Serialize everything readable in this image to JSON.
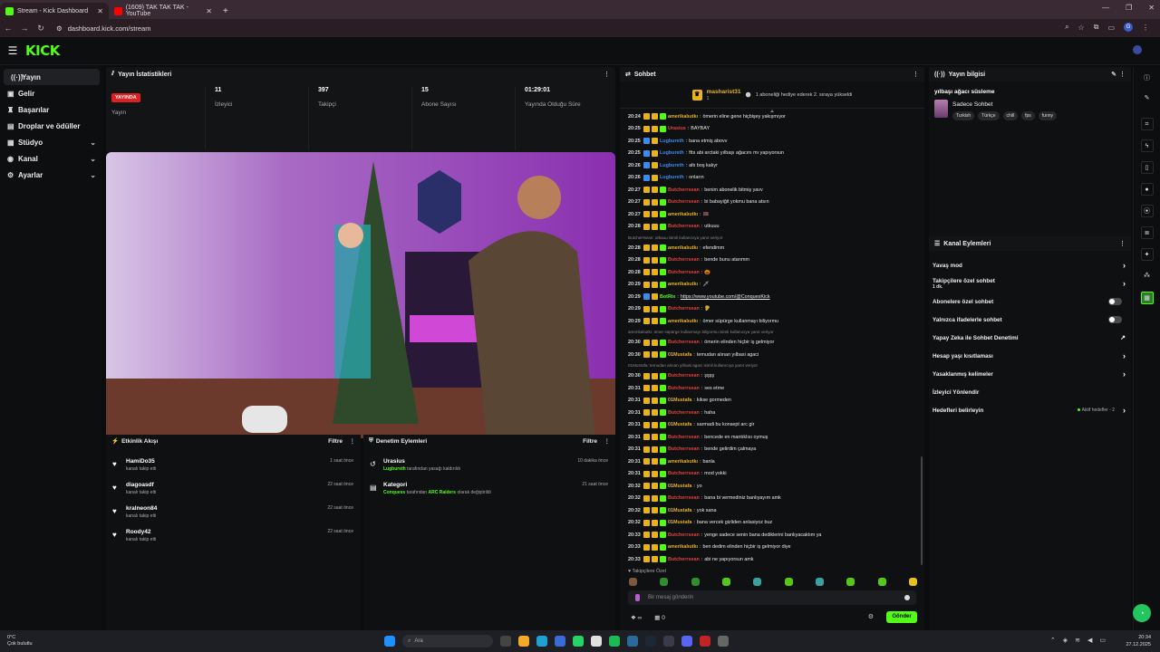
{
  "browser": {
    "tabs": [
      {
        "title": "Stream - Kick Dashboard",
        "icon": "kick-icon"
      },
      {
        "title": "(1609) TAK TAK TAK - YouTube",
        "icon": "youtube-icon"
      }
    ],
    "url": "dashboard.kick.com/stream",
    "profile_initial": "G"
  },
  "logo": "KICK",
  "sidebar": {
    "items": [
      {
        "label": "Yayın",
        "icon": "broadcast-icon",
        "active": true
      },
      {
        "label": "Gelir",
        "icon": "wallet-icon"
      },
      {
        "label": "Başarılar",
        "icon": "trophy-icon"
      },
      {
        "label": "Droplar ve ödüller",
        "icon": "gift-icon"
      },
      {
        "label": "Stüdyo",
        "icon": "studio-icon",
        "expandable": true
      },
      {
        "label": "Kanal",
        "icon": "channel-icon",
        "expandable": true
      },
      {
        "label": "Ayarlar",
        "icon": "settings-icon",
        "expandable": true
      }
    ]
  },
  "stats": {
    "title": "Yayın İstatistikleri",
    "live_badge": "YAYINDA",
    "cols": [
      {
        "value": "",
        "label": "Yayın"
      },
      {
        "value": "11",
        "label": "İzleyici"
      },
      {
        "value": "397",
        "label": "Takipçi"
      },
      {
        "value": "15",
        "label": "Abone Sayısı"
      },
      {
        "value": "01:29:01",
        "label": "Yayında Olduğu Süre"
      }
    ]
  },
  "activity": {
    "title": "Etkinlik Akışı",
    "filter": "Filtre",
    "items": [
      {
        "name": "HamiDo35",
        "sub": "kanalı takip etti",
        "time": "1 saat önce"
      },
      {
        "name": "diagoasdf",
        "sub": "kanalı takip etti",
        "time": "22 saat önce"
      },
      {
        "name": "kralneon84",
        "sub": "kanalı takip etti",
        "time": "22 saat önce"
      },
      {
        "name": "Roody42",
        "sub": "kanalı takip etti",
        "time": "22 saat önce"
      }
    ]
  },
  "moderation": {
    "title": "Denetim Eylemleri",
    "filter": "Filtre",
    "items": [
      {
        "title": "Urasius",
        "actor": "Lugbureth",
        "text": "tarafından yasağı kaldırıldı",
        "time": "10 dakika önce"
      },
      {
        "title": "Kategori",
        "actor": "Conquess",
        "text": "tarafından",
        "target": "ARC Raiders",
        "text2": "olarak değiştirildi",
        "time": "21 saat önce"
      }
    ]
  },
  "chat": {
    "title": "Sohbet",
    "pinned_user": "masharist31",
    "pinned_count": "1",
    "pinned_text": "1 aboneliği hediye ederek 2. sıraya yükseldi",
    "messages": [
      {
        "t": "20:24",
        "u": "amerikalıutkı",
        "c": "#e8b21a",
        "m": "ömerin eline gene hiçbişey yakışmıyor"
      },
      {
        "t": "20:25",
        "u": "Urasius",
        "c": "#e0403a",
        "m": "BAYBAY"
      },
      {
        "t": "20:25",
        "u": "Lugbureth",
        "c": "#3b8cf0",
        "m": "bana etmiş abovv"
      },
      {
        "t": "20:25",
        "u": "Lugbureth",
        "c": "#3b8cf0",
        "m": "ftts abi arctaki yılbaşı ağacını mı yapıyorsun"
      },
      {
        "t": "20:26",
        "u": "Lugbureth",
        "c": "#3b8cf0",
        "m": "altı boş kalıyr"
      },
      {
        "t": "20:26",
        "u": "Lugbureth",
        "c": "#3b8cf0",
        "m": "onların"
      },
      {
        "t": "20:27",
        "u": "Butcherrsean",
        "c": "#e0403a",
        "m": "benim abonelik bitmiş yavv"
      },
      {
        "t": "20:27",
        "u": "Butcherrsean",
        "c": "#e0403a",
        "m": "bi babayiğit yokmu bana atsın"
      },
      {
        "t": "20:27",
        "u": "amerikalıutkı",
        "c": "#e8b21a",
        "m": "🥅"
      },
      {
        "t": "20:28",
        "u": "Butcherrsean",
        "c": "#e0403a",
        "m": "utkuuu"
      },
      {
        "sys": "Butcherrsean: utkuuu isimli kullanıcıya yanıt veriyor"
      },
      {
        "t": "20:28",
        "u": "amerikalıutkı",
        "c": "#e8b21a",
        "m": "efendimm"
      },
      {
        "t": "20:28",
        "u": "Butcherrsean",
        "c": "#e0403a",
        "m": "bende bunu atarımm"
      },
      {
        "t": "20:28",
        "u": "Butcherrsean",
        "c": "#e0403a",
        "m": "🎃"
      },
      {
        "t": "20:29",
        "u": "amerikalıutkı",
        "c": "#e8b21a",
        "m": "🗡"
      },
      {
        "t": "20:29",
        "u": "BotRix",
        "c": "#53fc18",
        "m": "https://www.youtube.com/@ConquesKick",
        "link": true
      },
      {
        "t": "20:29",
        "u": "Butcherrsean",
        "c": "#e0403a",
        "m": "🦻"
      },
      {
        "t": "20:29",
        "u": "amerikalıutkı",
        "c": "#e8b21a",
        "m": "ömer süpürge kullanmayı biliyormu"
      },
      {
        "sys": "amerikalıutkı: ömer süpürge kullanmayı biliyormu isimli kullanıcıya yanıt veriyor"
      },
      {
        "t": "20:30",
        "u": "Butcherrsean",
        "c": "#e0403a",
        "m": "ömerin elinden hiçbir iş gelmiyor"
      },
      {
        "t": "20:30",
        "u": "01Mustafa",
        "c": "#e8b21a",
        "m": "temudan alınan yılbasi agaci"
      },
      {
        "sys": "01Mustafa: temudan alınan yılbasi agaci isimli kullanıcıya yanıt veriyor"
      },
      {
        "t": "20:30",
        "u": "Butcherrsean",
        "c": "#e0403a",
        "m": "şşşş"
      },
      {
        "t": "20:31",
        "u": "Butcherrsean",
        "c": "#e0403a",
        "m": "ses etme"
      },
      {
        "t": "20:31",
        "u": "01Mustafa",
        "c": "#e8b21a",
        "m": "kikse gormeden"
      },
      {
        "t": "20:31",
        "u": "Butcherrsean",
        "c": "#e0403a",
        "m": "haha"
      },
      {
        "t": "20:31",
        "u": "01Mustafa",
        "c": "#e8b21a",
        "m": "sarmadi bu konsept arc gir"
      },
      {
        "t": "20:31",
        "u": "Butcherrsean",
        "c": "#e0403a",
        "m": "bencede en mantıklısı oymuş"
      },
      {
        "t": "20:31",
        "u": "Butcherrsean",
        "c": "#e0403a",
        "m": "bende gelirdim çalmaya"
      },
      {
        "t": "20:31",
        "u": "amerikalıutkı",
        "c": "#e8b21a",
        "m": "banla"
      },
      {
        "t": "20:31",
        "u": "Butcherrsean",
        "c": "#e0403a",
        "m": "mod yokki"
      },
      {
        "t": "20:32",
        "u": "01Mustafa",
        "c": "#e8b21a",
        "m": "yo"
      },
      {
        "t": "20:32",
        "u": "Butcherrsean",
        "c": "#e0403a",
        "m": "bana bi vermediniz banlıyayım amk"
      },
      {
        "t": "20:32",
        "u": "01Mustafa",
        "c": "#e8b21a",
        "m": "yok sana"
      },
      {
        "t": "20:32",
        "u": "01Mustafa",
        "c": "#e8b21a",
        "m": "bana vercek gizliden anlasiyoz buz"
      },
      {
        "t": "20:33",
        "u": "Butcherrsean",
        "c": "#e0403a",
        "m": "yenge sadece senin bana dediklerini banlıyacaktım ya"
      },
      {
        "t": "20:33",
        "u": "amerikalıutkı",
        "c": "#e8b21a",
        "m": "ben dedim elinden hiçbir iş gelmiyor diye"
      },
      {
        "t": "20:33",
        "u": "Butcherrsean",
        "c": "#e0403a",
        "m": "abi ne yapıyorsun amk"
      }
    ],
    "followers_only": "Takipçilere Özel",
    "input_placeholder": "Bir mesaj gönderin",
    "infinity": "∞",
    "count": "0",
    "send": "Gönder"
  },
  "stream_info": {
    "title": "Yayın bilgisi",
    "stream_title": "yılbaşı ağacı süsleme",
    "category": "Sadece Sohbet",
    "tags": [
      "Turkish",
      "Türkçe",
      "chill",
      "fps",
      "funny"
    ]
  },
  "channel_actions": {
    "title": "Kanal Eylemleri",
    "items": [
      {
        "label": "Yavaş mod",
        "control": "arrow"
      },
      {
        "label": "Takipçilere özel sohbet",
        "sub": "1 dk.",
        "control": "arrow"
      },
      {
        "label": "Abonelere özel sohbet",
        "control": "toggle"
      },
      {
        "label": "Yalnızca ifadelerle sohbet",
        "control": "toggle"
      },
      {
        "label": "Yapay Zeka ile Sohbet Denetimi",
        "control": "external"
      },
      {
        "label": "Hesap yaşı kısıtlaması",
        "control": "arrow"
      },
      {
        "label": "Yasaklanmış kelimeler",
        "control": "arrow"
      },
      {
        "label": "İzleyici Yönlendir",
        "control": "none"
      },
      {
        "label": "Hedefleri belirleyin",
        "right": "Aktif hedefler - 2",
        "control": "arrow"
      }
    ]
  },
  "taskbar": {
    "weather_temp": "0°C",
    "weather_text": "Çok bulutlu",
    "search": "Ara",
    "time": "20:34",
    "date": "27.12.2025"
  }
}
